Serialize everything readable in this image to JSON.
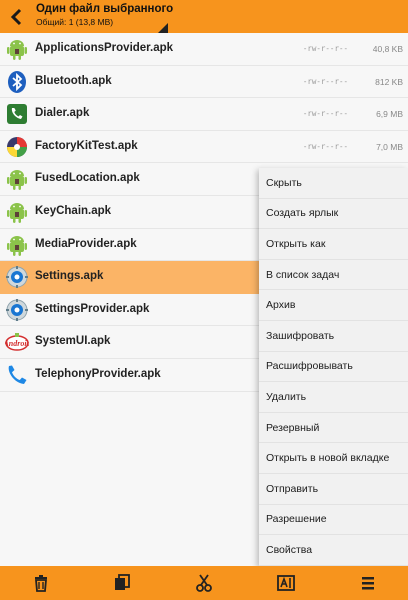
{
  "header": {
    "title": "Один файл выбранного",
    "subtitle": "Общий: 1 (13,8 MB)"
  },
  "files": [
    {
      "name": "ApplicationsProvider.apk",
      "perm": "-rw-r--r--",
      "size": "40,8 KB",
      "icon": "android-icon"
    },
    {
      "name": "Bluetooth.apk",
      "perm": "-rw-r--r--",
      "size": "812 KB",
      "icon": "bluetooth-icon"
    },
    {
      "name": "Dialer.apk",
      "perm": "-rw-r--r--",
      "size": "6,9 MB",
      "icon": "phone-icon"
    },
    {
      "name": "FactoryKitTest.apk",
      "perm": "-rw-r--r--",
      "size": "7,0 MB",
      "icon": "factory-kit-icon"
    },
    {
      "name": "FusedLocation.apk",
      "perm": "",
      "size": "",
      "icon": "android-icon"
    },
    {
      "name": "KeyChain.apk",
      "perm": "",
      "size": "",
      "icon": "android-icon"
    },
    {
      "name": "MediaProvider.apk",
      "perm": "",
      "size": "",
      "icon": "android-icon"
    },
    {
      "name": "Settings.apk",
      "perm": "",
      "size": "",
      "icon": "settings-gear-icon",
      "selected": true
    },
    {
      "name": "SettingsProvider.apk",
      "perm": "",
      "size": "",
      "icon": "settings-gear-icon"
    },
    {
      "name": "SystemUI.apk",
      "perm": "",
      "size": "",
      "icon": "android-logo-icon"
    },
    {
      "name": "TelephonyProvider.apk",
      "perm": "",
      "size": "",
      "icon": "phone-handset-icon"
    }
  ],
  "menu": [
    "Скрыть",
    "Создать ярлык",
    "Открыть как",
    "В список задач",
    "Архив",
    "Зашифровать",
    "Расшифровывать",
    "Удалить",
    "Резервный",
    "Открыть в новой вкладке",
    "Отправить",
    "Разрешение",
    "Свойства"
  ],
  "bottom_bar": [
    "delete-icon",
    "copy-icon",
    "cut-icon",
    "rename-icon",
    "more-icon"
  ],
  "colors": {
    "accent": "#f7941d",
    "selected_row": "#fbb466"
  }
}
